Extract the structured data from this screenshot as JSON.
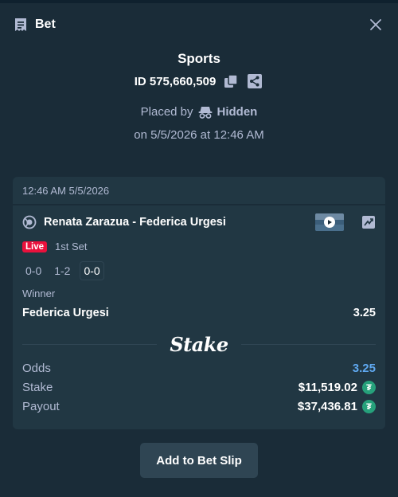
{
  "header": {
    "title": "Bet",
    "icon": "receipt-icon",
    "close_icon": "close-icon"
  },
  "bet": {
    "category": "Sports",
    "id_prefix": "ID",
    "id_value": "575,660,509",
    "placed_by_label": "Placed by",
    "placed_by_name": "Hidden",
    "date_text": "on 5/5/2026 at 12:46 AM"
  },
  "card": {
    "timestamp": "12:46 AM 5/5/2026",
    "match_name": "Renata Zarazua - Federica Urgesi",
    "live_label": "Live",
    "set_label": "1st Set",
    "scores": [
      "0-0",
      "1-2",
      "0-0"
    ],
    "market": "Winner",
    "outcome": "Federica Urgesi",
    "outcome_odds": "3.25",
    "brand": "Stake",
    "odds_label": "Odds",
    "odds_value": "3.25",
    "stake_label": "Stake",
    "stake_value": "$11,519.02",
    "payout_label": "Payout",
    "payout_value": "$37,436.81",
    "currency_symbol": "₮"
  },
  "actions": {
    "add_label": "Add to Bet Slip"
  },
  "colors": {
    "bg": "#1a2c38",
    "card": "#213743",
    "button": "#2f4553",
    "live": "#e9113c",
    "odds": "#5fa8f0",
    "tether": "#26a17b"
  }
}
